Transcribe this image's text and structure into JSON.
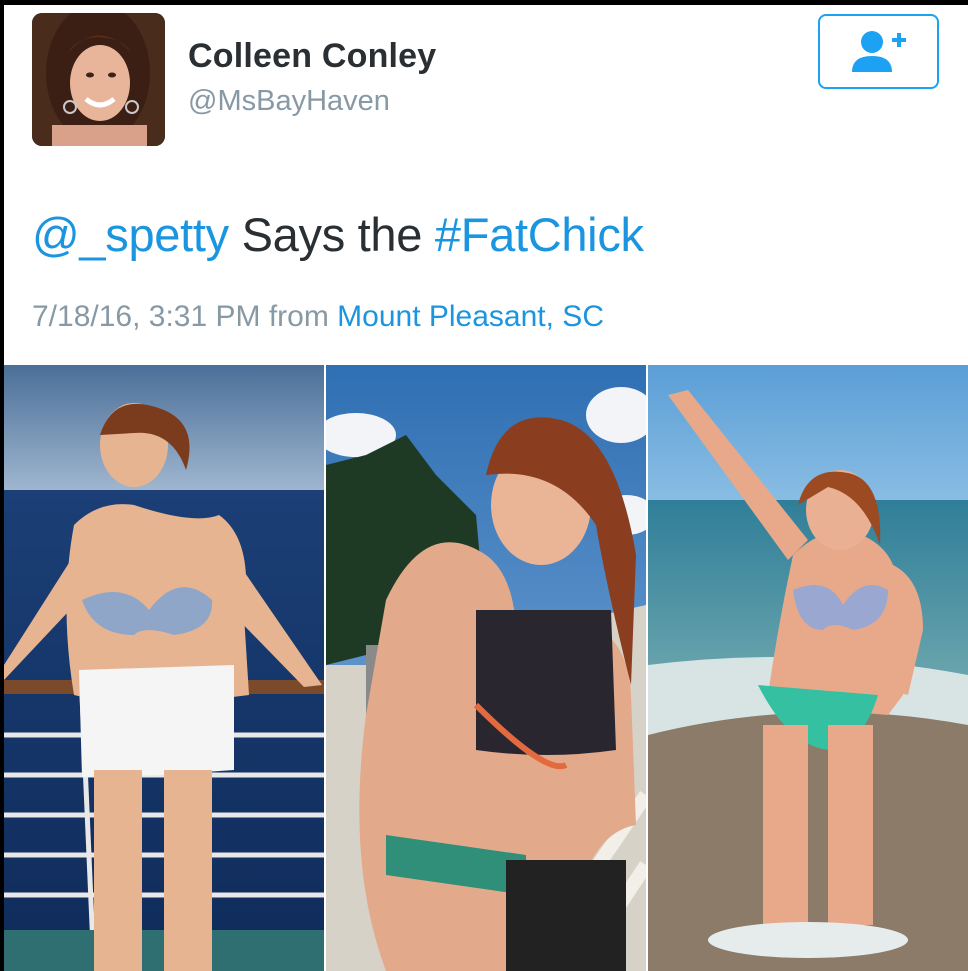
{
  "user": {
    "display_name": "Colleen Conley",
    "handle": "@MsBayHaven",
    "avatar_icon": "profile-photo"
  },
  "follow_button": {
    "icon": "add-user-icon",
    "color": "#1da1f2"
  },
  "tweet": {
    "mention": "@_spetty",
    "body": " Says the ",
    "hashtag": "#FatChick"
  },
  "meta": {
    "timestamp": "7/18/16, 3:31 PM",
    "from": " from ",
    "location": "Mount Pleasant, SC"
  },
  "media": {
    "photo_count": 3,
    "photos": [
      "photo-1",
      "photo-2",
      "photo-3"
    ]
  },
  "colors": {
    "link": "#1b95e0",
    "text": "#292f33",
    "secondary": "#8899a6"
  }
}
